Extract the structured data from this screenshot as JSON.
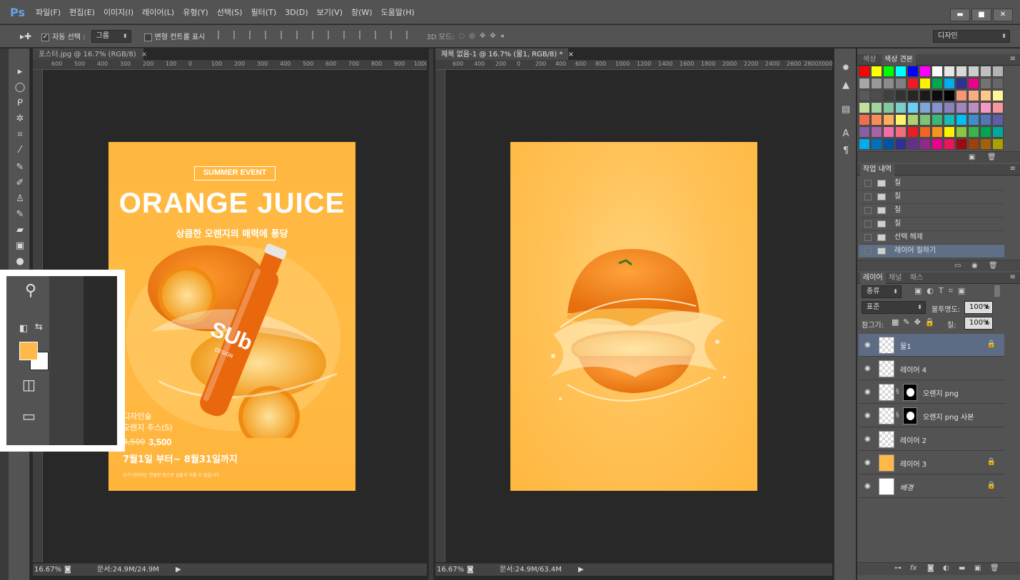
{
  "app": {
    "logo": "Ps"
  },
  "menu": [
    "파일(F)",
    "편집(E)",
    "이미지(I)",
    "레이어(L)",
    "유형(Y)",
    "선택(S)",
    "필터(T)",
    "3D(D)",
    "보기(V)",
    "창(W)",
    "도움말(H)"
  ],
  "window_controls": {
    "minimize": "▬",
    "restore": "■",
    "close": "✕"
  },
  "options": {
    "auto_select_label": "자동 선택 :",
    "auto_select_value": "그룹",
    "transform_label": "변형 컨트롤 표시",
    "mode_3d_label": "3D 모드:",
    "workspace": "디자인"
  },
  "colors": {
    "accent": "#5fa6e8",
    "fg_color": "#ffb94a",
    "bg_color": "#ffffff",
    "poster_orange": "#ffb63e"
  },
  "docs": [
    {
      "tab": "포스터.jpg @ 16.7% (RGB/8)",
      "close": "×",
      "zoom": "16.67%",
      "status": "문서:24.9M/24.9M",
      "ruler_numbers": [
        "600",
        "500",
        "400",
        "300",
        "200",
        "100",
        "0",
        "100",
        "200",
        "300",
        "400",
        "500",
        "600",
        "700",
        "800",
        "900",
        "1000"
      ]
    },
    {
      "tab": "제목 없음-1 @ 16.7% (물1, RGB/8) *",
      "close": "×",
      "zoom": "16.67%",
      "status": "문서:24.9M/63.4M",
      "ruler_numbers": [
        "600",
        "400",
        "200",
        "0",
        "200",
        "400",
        "600",
        "800",
        "1000",
        "1200",
        "1400",
        "1600",
        "1800",
        "2000",
        "2200",
        "2400",
        "2600",
        "2800",
        "3000"
      ]
    }
  ],
  "poster": {
    "event": "SUMMER EVENT",
    "title": "ORANGE JUICE",
    "subtitle": "상큼한 오렌지의 매력에 퐁당",
    "bottle_logo": "SUb",
    "bottle_sub": "DESIGN",
    "line1": "디자인숲",
    "line2": "오렌지 주스(S)",
    "price_old": "4,500",
    "price_new": "3,500",
    "dates": "7월1일 부터~ 8월31일까지",
    "fine_print": "상기 이미지는 연출된 컷으로 실물과 다를 수 있습니다"
  },
  "panels": {
    "color_tabs": [
      "색상",
      "색상 견본"
    ],
    "history_title": "작업 내역",
    "history": [
      "칠",
      "칠",
      "칠",
      "칠",
      "선택 해제",
      "레이어 칠하기"
    ],
    "layer_tabs": [
      "레이어",
      "채널",
      "패스"
    ],
    "filter_kind": "종류",
    "blend_mode": "표준",
    "opacity_label": "불투명도:",
    "opacity_value": "100%",
    "lock_label": "잠그기:",
    "fill_label": "칠:",
    "fill_value": "100%",
    "layers": [
      {
        "name": "물1",
        "locked": true,
        "selected": true
      },
      {
        "name": "레이어 4",
        "locked": false,
        "selected": false
      },
      {
        "name": "오렌지 png",
        "locked": false,
        "selected": false,
        "mask": true
      },
      {
        "name": "오렌지 png 사본",
        "locked": false,
        "selected": false,
        "mask": true
      },
      {
        "name": "레이어 2",
        "locked": false,
        "selected": false
      },
      {
        "name": "레이어 3",
        "locked": true,
        "selected": false
      },
      {
        "name": "배경",
        "locked": true,
        "selected": false
      }
    ],
    "lock_symbol": "🔒",
    "eye_symbol": "◉"
  },
  "swatch_rows": [
    [
      "#ff0000",
      "#ffff00",
      "#00ff00",
      "#00ffff",
      "#0000ff",
      "#ff00ff",
      "#ffffff",
      "#e6e6e6",
      "#d9d9d9",
      "#cccccc",
      "#c0c0c0",
      "#b3b3b3"
    ],
    [
      "#a6a6a6",
      "#999999",
      "#8c8c8c",
      "#808080",
      "#ed1c24",
      "#fff200",
      "#00a651",
      "#00aeef",
      "#2e3192",
      "#ec008c",
      "#737373",
      "#666666"
    ],
    [
      "#595959",
      "#4d4d4d",
      "#404040",
      "#333333",
      "#262626",
      "#1a1a1a",
      "#0d0d0d",
      "#000000",
      "#f7977a",
      "#f9ad81",
      "#fdc68a",
      "#fff79a"
    ],
    [
      "#c4df9b",
      "#a3d39c",
      "#82ca9d",
      "#7bcdc8",
      "#6ecff6",
      "#7ea7d8",
      "#8493ca",
      "#8882be",
      "#a187be",
      "#bc8dbf",
      "#f49ac2",
      "#f6989d"
    ],
    [
      "#f26c4f",
      "#f68e55",
      "#fbaf5c",
      "#fff467",
      "#acd372",
      "#7cc576",
      "#3bb878",
      "#1abbb4",
      "#00bff3",
      "#438ccb",
      "#5574b9",
      "#605ca8"
    ],
    [
      "#855fa8",
      "#a763a8",
      "#f06eaa",
      "#f26d7d",
      "#ed1c24",
      "#f26522",
      "#f7941d",
      "#fff200",
      "#8dc63f",
      "#39b54a",
      "#00a651",
      "#00a99d"
    ],
    [
      "#00aeef",
      "#0072bc",
      "#0054a6",
      "#2e3192",
      "#662d91",
      "#92278f",
      "#ec008c",
      "#ed145b",
      "#9e0b0f",
      "#a0410d",
      "#a3620a",
      "#aba000"
    ]
  ]
}
